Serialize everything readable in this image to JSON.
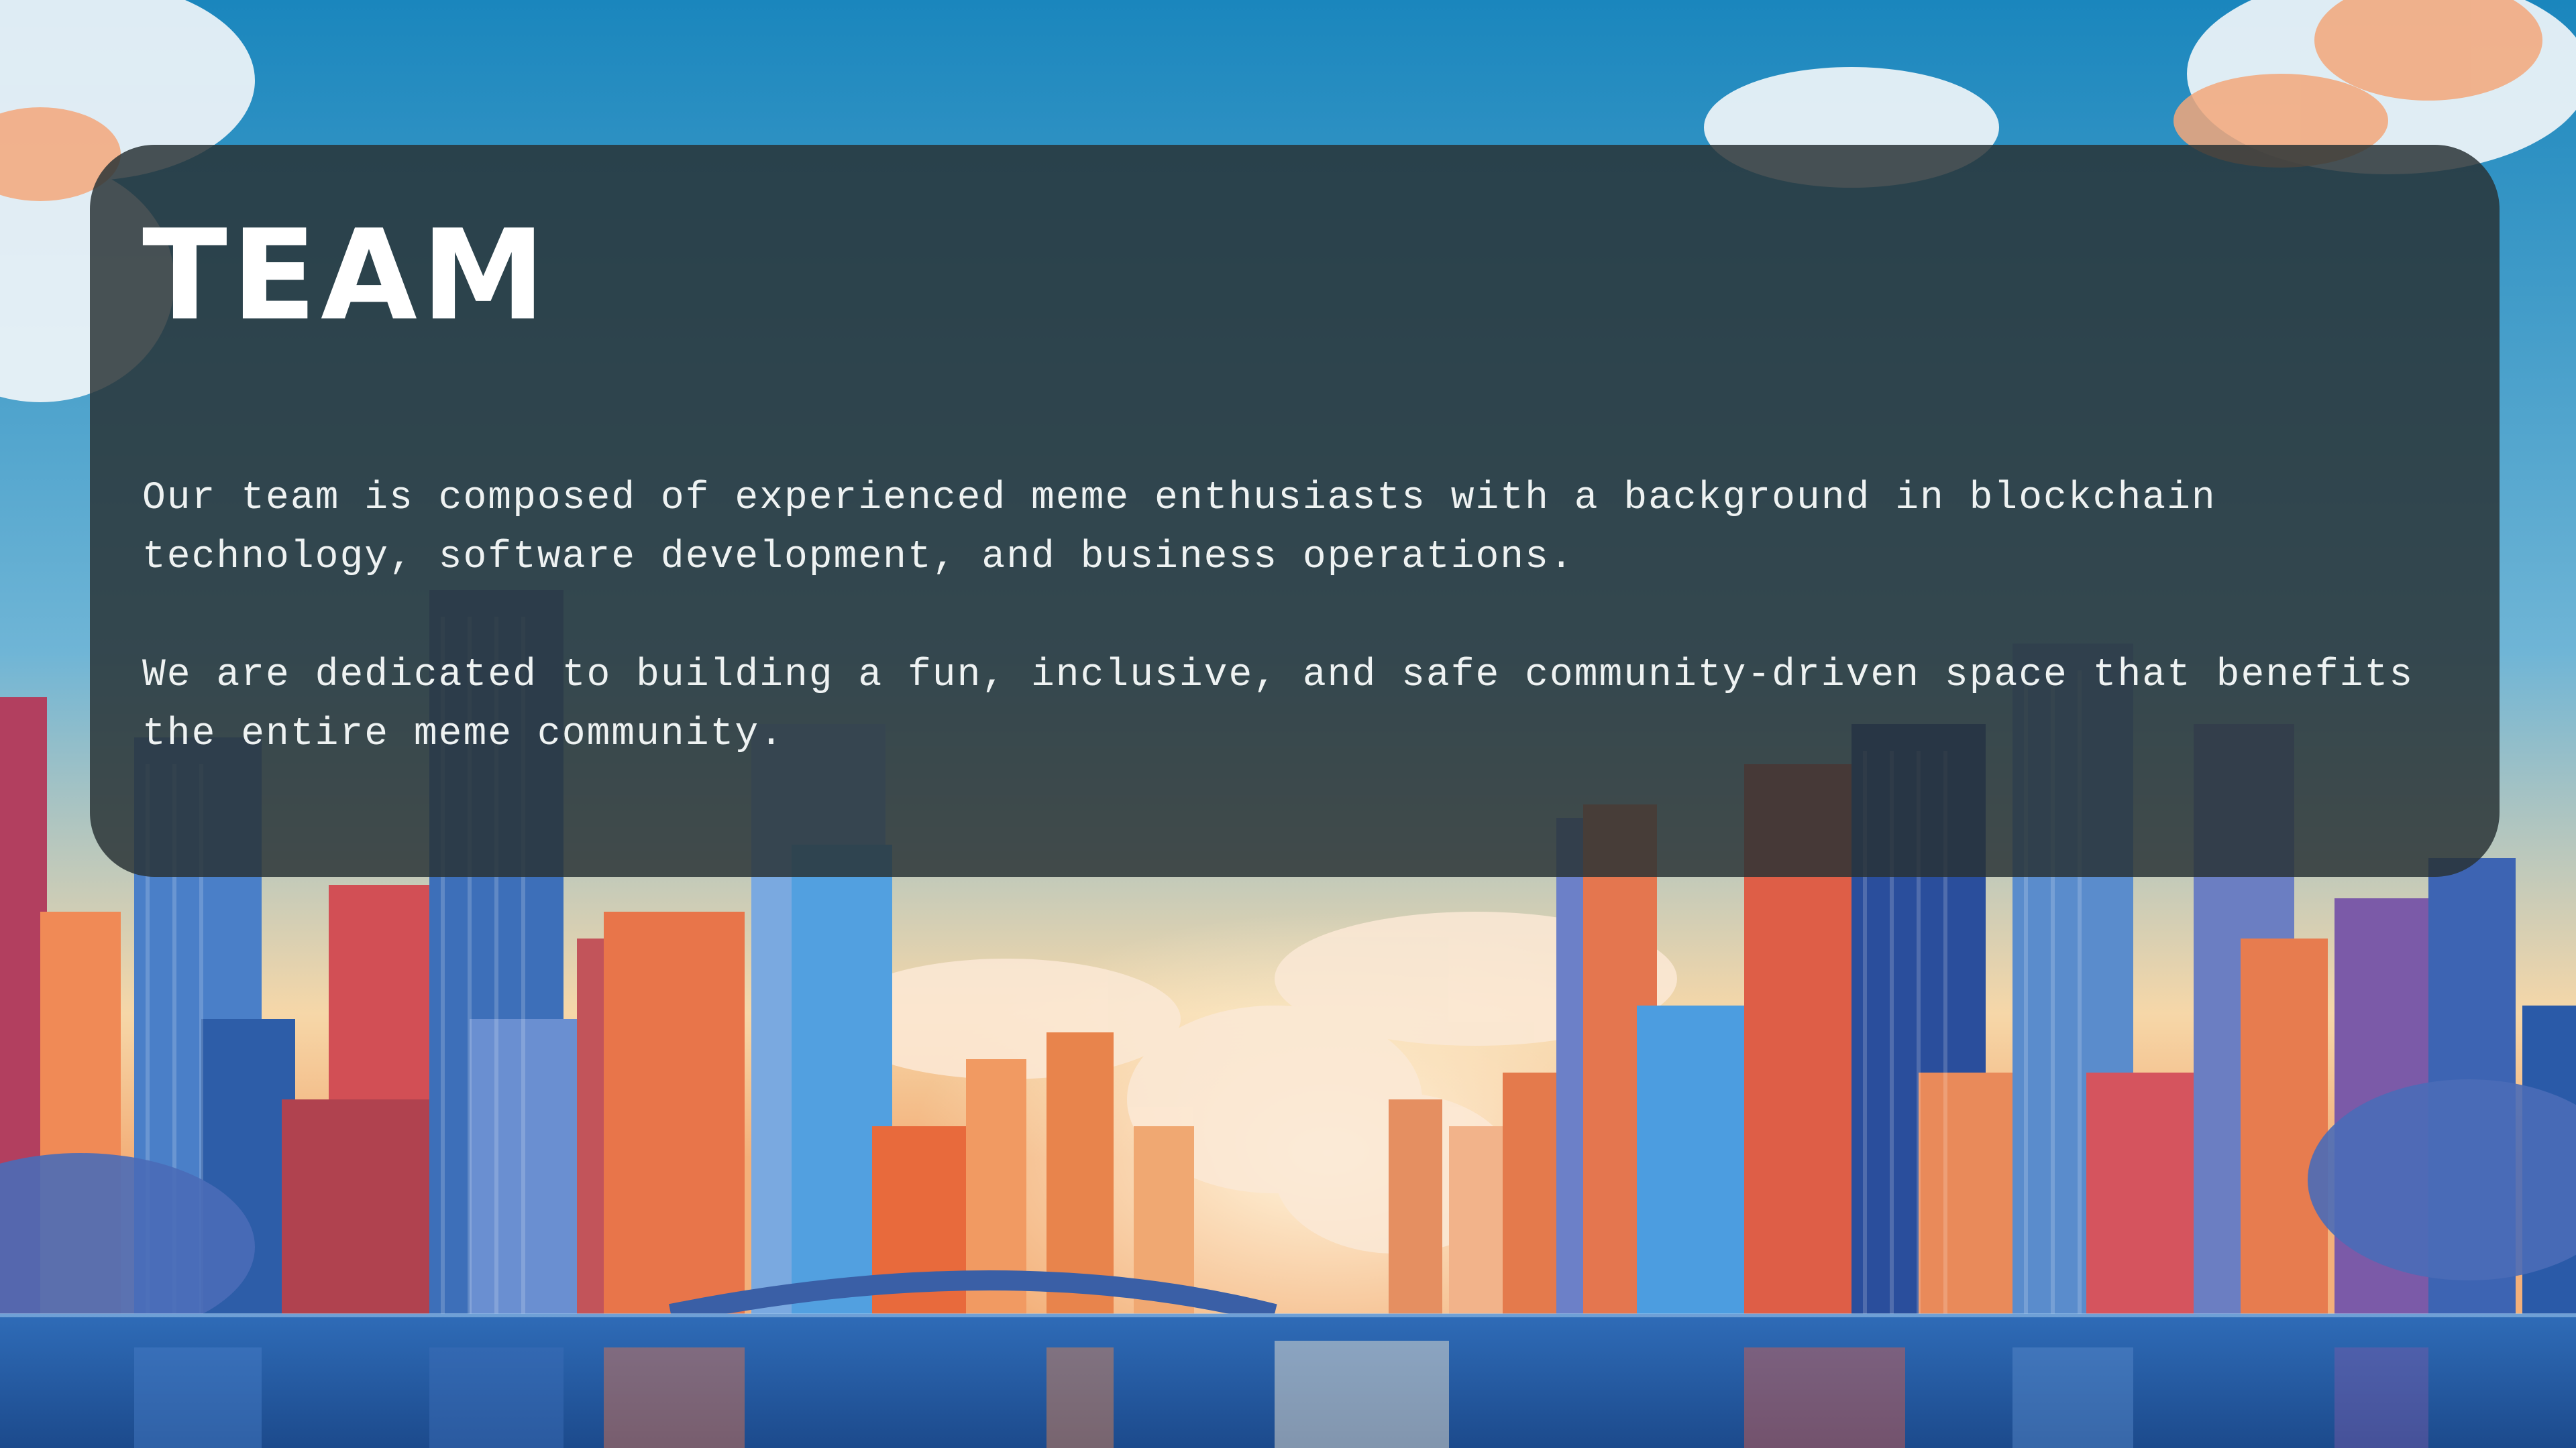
{
  "slide": {
    "title": "TEAM",
    "paragraphs": [
      "Our team is composed of experienced meme enthusiasts with a background in blockchain technology, software development, and business operations.",
      "We are dedicated to building a fun, inclusive, and safe community-driven space that benefits the entire meme community."
    ]
  },
  "colors": {
    "sky_top": "#1a86bd",
    "sky_mid": "#7bbad6",
    "horizon": "#f6d7a8",
    "water": "#2a5fa8",
    "panel": "#283234",
    "text": "#ffffff"
  }
}
